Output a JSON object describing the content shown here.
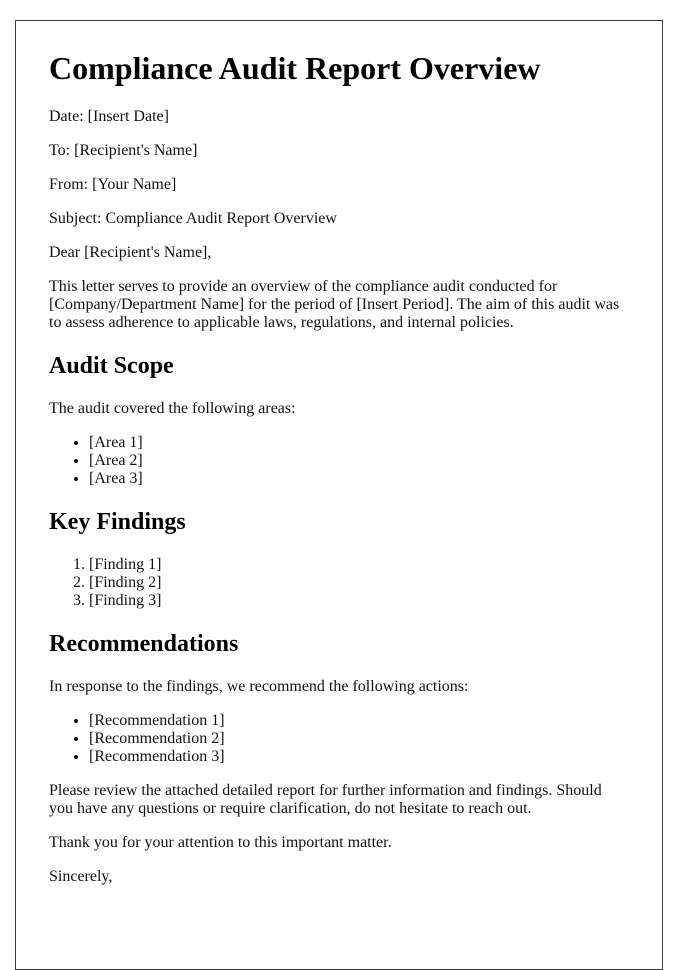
{
  "document": {
    "title": "Compliance Audit Report Overview",
    "header_fields": [
      {
        "label": "Date:",
        "value": "[Insert Date]"
      },
      {
        "label": "To:",
        "value": "[Recipient's Name]"
      },
      {
        "label": "From:",
        "value": "[Your Name]"
      },
      {
        "label": "Subject:",
        "value": "Compliance Audit Report Overview"
      }
    ],
    "salutation": "Dear [Recipient's Name],",
    "intro": "This letter serves to provide an overview of the compliance audit conducted for [Company/Department Name] for the period of [Insert Period]. The aim of this audit was to assess adherence to applicable laws, regulations, and internal policies.",
    "sections": {
      "scope": {
        "heading": "Audit Scope",
        "lead": "The audit covered the following areas:",
        "items": [
          "[Area 1]",
          "[Area 2]",
          "[Area 3]"
        ]
      },
      "findings": {
        "heading": "Key Findings",
        "items": [
          "[Finding 1]",
          "[Finding 2]",
          "[Finding 3]"
        ]
      },
      "recommendations": {
        "heading": "Recommendations",
        "lead": "In response to the findings, we recommend the following actions:",
        "items": [
          "[Recommendation 1]",
          "[Recommendation 2]",
          "[Recommendation 3]"
        ]
      }
    },
    "closing_paragraph": "Please review the attached detailed report for further information and findings. Should you have any questions or require clarification, do not hesitate to reach out.",
    "thanks": "Thank you for your attention to this important matter.",
    "sign_off": "Sincerely,"
  }
}
